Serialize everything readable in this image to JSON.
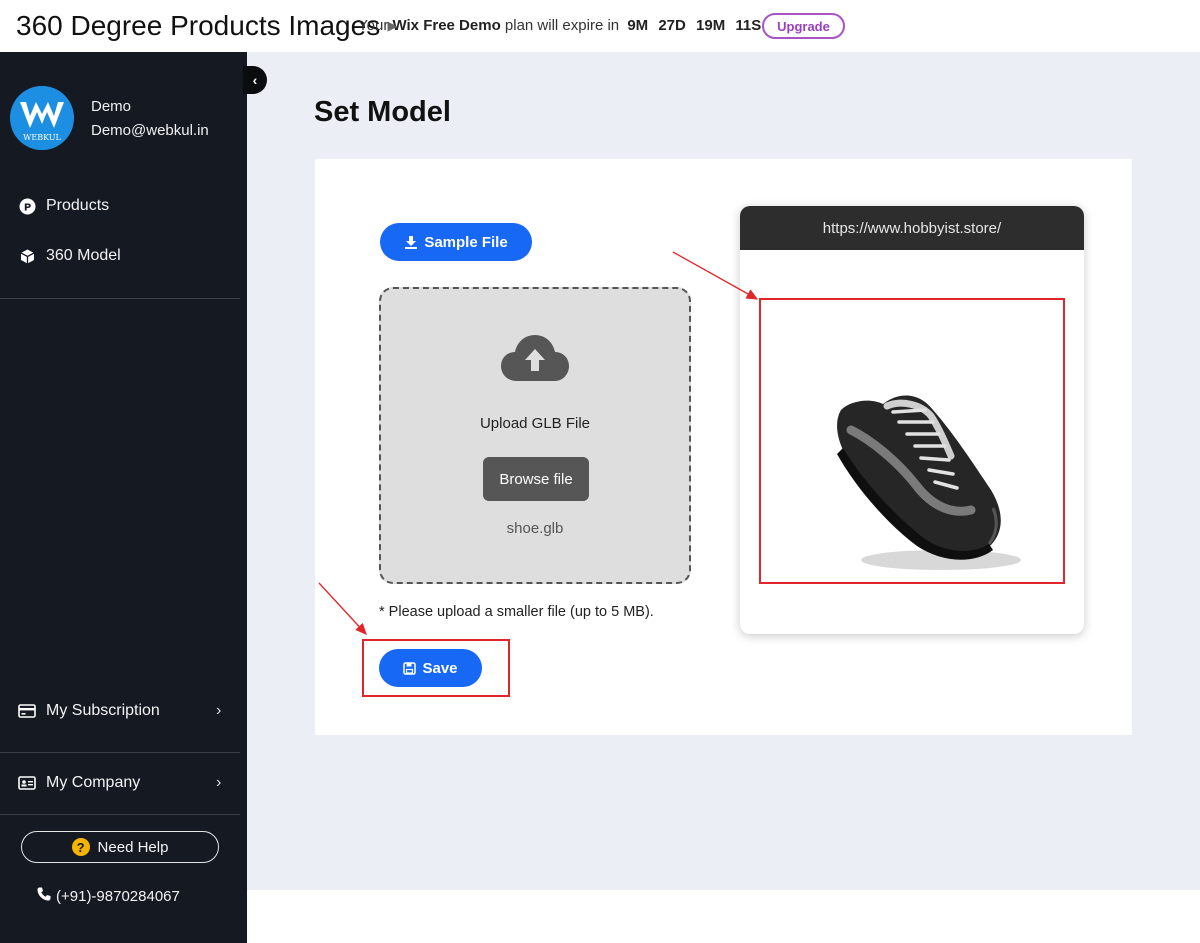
{
  "topbar": {
    "app_title": "360 Degree Products Images",
    "msg_prefix": "Your",
    "msg_brand": "Wix",
    "msg_plan": "Free Demo",
    "msg_suffix": "plan will expire in",
    "countdown": [
      "9M",
      "27D",
      "19M",
      "11S"
    ],
    "upgrade_label": "Upgrade"
  },
  "sidebar": {
    "user_name": "Demo",
    "user_email": "Demo@webkul.in",
    "avatar_text": "WEBKUL",
    "nav": [
      {
        "label": "Products",
        "icon": "products-p-icon"
      },
      {
        "label": "360 Model",
        "icon": "cube-icon"
      }
    ],
    "bottom_nav": [
      {
        "label": "My Subscription",
        "icon": "credit-card-icon"
      },
      {
        "label": "My Company",
        "icon": "id-card-icon"
      }
    ],
    "help_label": "Need Help",
    "phone": "(+91)-9870284067"
  },
  "main": {
    "page_title": "Set Model",
    "sample_file_label": "Sample File",
    "upload_label": "Upload GLB File",
    "browse_label": "Browse file",
    "file_name": "shoe.glb",
    "hint": "* Please upload a smaller file (up to 5 MB).",
    "save_label": "Save",
    "preview_url": "https://www.hobbyist.store/"
  },
  "colors": {
    "primary": "#1668f5",
    "sidebar_bg": "#151922",
    "highlight_red": "#e0262b",
    "upgrade_purple": "#9b3fc0"
  }
}
